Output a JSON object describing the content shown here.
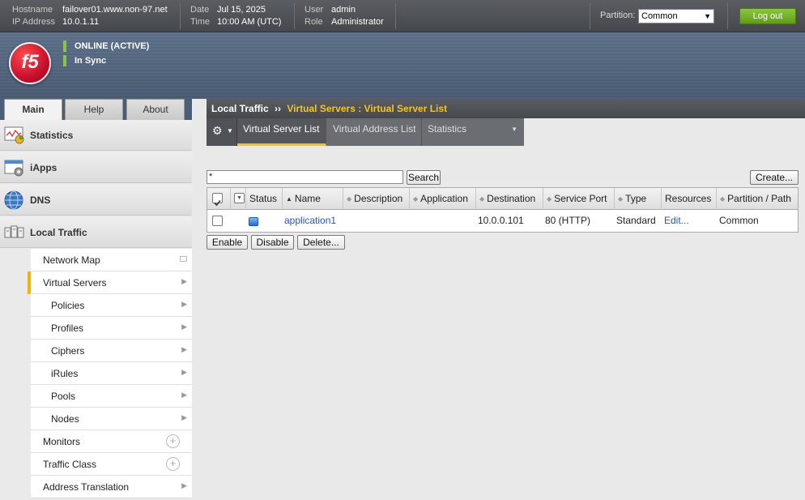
{
  "header": {
    "hostname_label": "Hostname",
    "hostname": "failover01.www.non-97.net",
    "ip_label": "IP Address",
    "ip": "10.0.1.11",
    "date_label": "Date",
    "date": "Jul 15, 2025",
    "time_label": "Time",
    "time": "10:00 AM (UTC)",
    "user_label": "User",
    "user": "admin",
    "role_label": "Role",
    "role": "Administrator",
    "partition_label": "Partition:",
    "partition_value": "Common",
    "logout_label": "Log out"
  },
  "banner": {
    "logo_text": "f5",
    "status_online": "ONLINE (ACTIVE)",
    "status_sync": "In Sync",
    "status_color": "#8bc34a"
  },
  "tabs": [
    {
      "label": "Main",
      "active": true
    },
    {
      "label": "Help",
      "active": false
    },
    {
      "label": "About",
      "active": false
    }
  ],
  "sidebar": {
    "sections": [
      {
        "label": "Statistics",
        "icon": "statistics-icon"
      },
      {
        "label": "iApps",
        "icon": "iapps-icon"
      },
      {
        "label": "DNS",
        "icon": "dns-globe-icon"
      },
      {
        "label": "Local Traffic",
        "icon": "local-traffic-icon"
      }
    ],
    "items": [
      {
        "label": "Network Map"
      },
      {
        "label": "Virtual Servers"
      },
      {
        "label": "Policies"
      },
      {
        "label": "Profiles"
      },
      {
        "label": "Ciphers"
      },
      {
        "label": "iRules"
      },
      {
        "label": "Pools"
      },
      {
        "label": "Nodes"
      },
      {
        "label": "Monitors"
      },
      {
        "label": "Traffic Class"
      },
      {
        "label": "Address Translation"
      }
    ]
  },
  "breadcrumb": {
    "root": "Local Traffic",
    "separator": "››",
    "current": "Virtual Servers : Virtual Server List"
  },
  "subtabs": [
    {
      "label": "Virtual Server List",
      "active": true
    },
    {
      "label": "Virtual Address List",
      "active": false
    },
    {
      "label": "Statistics",
      "active": false
    }
  ],
  "search": {
    "value": "*",
    "button_label": "Search",
    "create_label": "Create..."
  },
  "table": {
    "columns": [
      "Status",
      "Name",
      "Description",
      "Application",
      "Destination",
      "Service Port",
      "Type",
      "Resources",
      "Partition / Path"
    ],
    "rows": [
      {
        "name": "application1",
        "description": "",
        "application": "",
        "destination": "10.0.0.101",
        "service_port": "80 (HTTP)",
        "type": "Standard",
        "resources": "Edit...",
        "partition": "Common"
      }
    ]
  },
  "actions": {
    "enable": "Enable",
    "disable": "Disable",
    "delete": "Delete..."
  },
  "colors": {
    "accent_yellow": "#f5c518",
    "logout_green": "#6fae21",
    "link_blue": "#2255bb"
  }
}
